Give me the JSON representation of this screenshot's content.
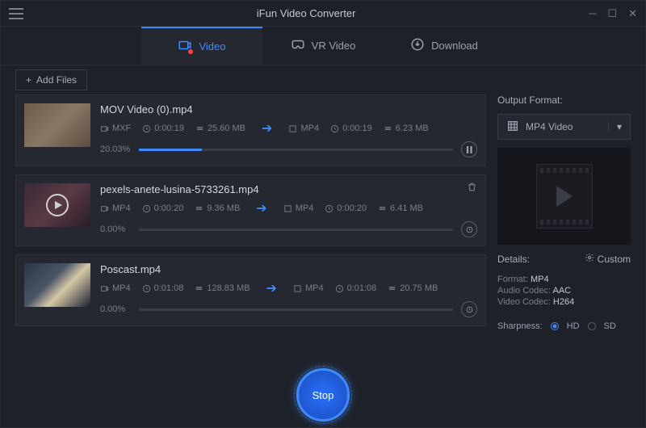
{
  "window": {
    "title": "iFun Video Converter"
  },
  "tabs": {
    "video": "Video",
    "vr": "VR Video",
    "download": "Download"
  },
  "toolbar": {
    "add_files": "Add Files"
  },
  "items": [
    {
      "title": "MOV Video (0).mp4",
      "src_fmt": "MXF",
      "src_dur": "0:00:19",
      "src_size": "25.60 MB",
      "dst_fmt": "MP4",
      "dst_dur": "0:00:19",
      "dst_size": "6.23 MB",
      "pct": "20.03%",
      "pct_val": 20.03,
      "state": "running"
    },
    {
      "title": "pexels-anete-lusina-5733261.mp4",
      "src_fmt": "MP4",
      "src_dur": "0:00:20",
      "src_size": "9.36 MB",
      "dst_fmt": "MP4",
      "dst_dur": "0:00:20",
      "dst_size": "6.41 MB",
      "pct": "0.00%",
      "pct_val": 0,
      "state": "pending"
    },
    {
      "title": "Poscast.mp4",
      "src_fmt": "MP4",
      "src_dur": "0:01:08",
      "src_size": "128.83 MB",
      "dst_fmt": "MP4",
      "dst_dur": "0:01:08",
      "dst_size": "20.75 MB",
      "pct": "0.00%",
      "pct_val": 0,
      "state": "pending"
    }
  ],
  "side": {
    "output_label": "Output Format:",
    "format": "MP4 Video",
    "details_label": "Details:",
    "custom": "Custom",
    "format_line_k": "Format:",
    "format_line_v": "MP4",
    "audio_k": "Audio Codec:",
    "audio_v": "AAC",
    "video_k": "Video Codec:",
    "video_v": "H264",
    "sharp_label": "Sharpness:",
    "hd": "HD",
    "sd": "SD"
  },
  "footer": {
    "stop": "Stop"
  }
}
